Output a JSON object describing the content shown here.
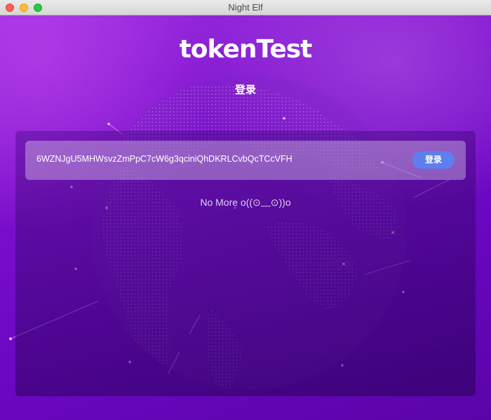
{
  "window": {
    "title": "Night Elf"
  },
  "brand": {
    "logo_text": "tokenTest"
  },
  "page": {
    "heading": "登录"
  },
  "login_form": {
    "private_key_value": "6WZNJgU5MHWsvzZmPpC7cW6g3qciniQhDKRLCvbQcTCcVFH",
    "login_button_label": "登录"
  },
  "status": {
    "message": "No More o((⊙﹏⊙))o"
  },
  "colors": {
    "background_purple": "#7a10c8",
    "login_button": "#5d7ff0",
    "text_white": "#ffffff"
  }
}
